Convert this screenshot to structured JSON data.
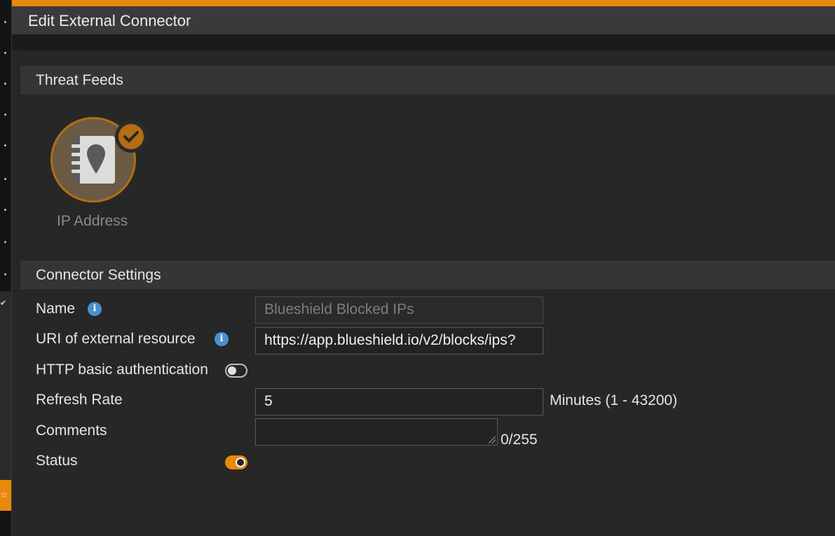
{
  "dialog": {
    "title": "Edit External Connector"
  },
  "threat_feeds": {
    "header": "Threat Feeds",
    "items": [
      {
        "label": "IP Address",
        "icon": "address-book-location-icon",
        "selected": true
      }
    ]
  },
  "connector_settings": {
    "header": "Connector Settings",
    "name": {
      "label": "Name",
      "value": "Blueshield Blocked IPs"
    },
    "uri": {
      "label": "URI of external resource",
      "value": "https://app.blueshield.io/v2/blocks/ips?"
    },
    "http_auth": {
      "label": "HTTP basic authentication",
      "enabled": false
    },
    "refresh_rate": {
      "label": "Refresh Rate",
      "value": "5",
      "hint": "Minutes (1 - 43200)"
    },
    "comments": {
      "label": "Comments",
      "value": "",
      "counter": "0/255"
    },
    "status": {
      "label": "Status",
      "enabled": true
    }
  },
  "colors": {
    "accent": "#e8890c",
    "info": "#4b8fd1",
    "background": "#262626"
  }
}
